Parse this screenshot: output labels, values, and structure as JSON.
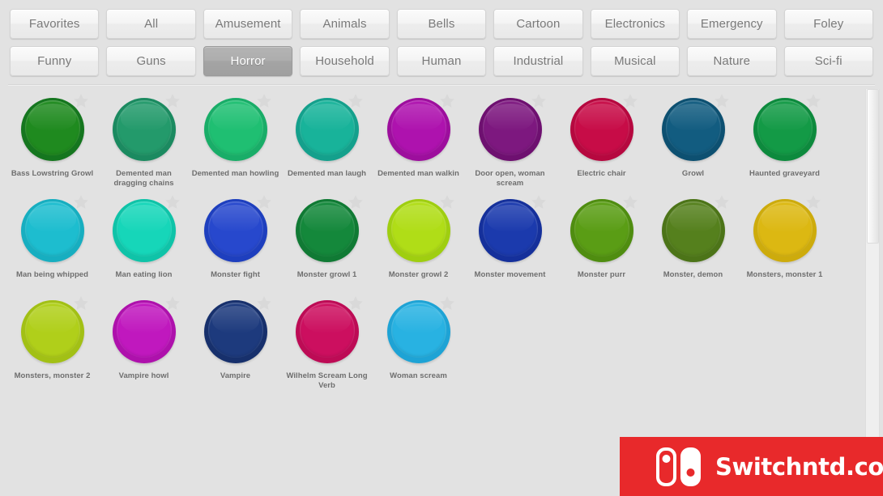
{
  "tabs": {
    "row1": [
      {
        "label": "Favorites",
        "active": false
      },
      {
        "label": "All",
        "active": false
      },
      {
        "label": "Amusement",
        "active": false
      },
      {
        "label": "Animals",
        "active": false
      },
      {
        "label": "Bells",
        "active": false
      },
      {
        "label": "Cartoon",
        "active": false
      },
      {
        "label": "Electronics",
        "active": false
      },
      {
        "label": "Emergency",
        "active": false
      },
      {
        "label": "Foley",
        "active": false
      }
    ],
    "row2": [
      {
        "label": "Funny",
        "active": false
      },
      {
        "label": "Guns",
        "active": false
      },
      {
        "label": "Horror",
        "active": true
      },
      {
        "label": "Household",
        "active": false
      },
      {
        "label": "Human",
        "active": false
      },
      {
        "label": "Industrial",
        "active": false
      },
      {
        "label": "Musical",
        "active": false
      },
      {
        "label": "Nature",
        "active": false
      },
      {
        "label": "Sci-fi",
        "active": false
      }
    ]
  },
  "active_category": "Horror",
  "sounds": [
    {
      "label": "Bass Lowstring Growl",
      "ring": "#15761f",
      "top": "#1f8a1f",
      "favorite": false
    },
    {
      "label": "Demented man dragging chains",
      "ring": "#1b8a60",
      "top": "#239a6b",
      "favorite": false
    },
    {
      "label": "Demented man howling",
      "ring": "#19ad68",
      "top": "#1fbf72",
      "favorite": false
    },
    {
      "label": "Demented man laugh",
      "ring": "#14a08c",
      "top": "#18b39a",
      "favorite": false
    },
    {
      "label": "Demented man walkin",
      "ring": "#9d0e9d",
      "top": "#ae12ae",
      "favorite": false
    },
    {
      "label": "Door open, woman scream",
      "ring": "#6e1070",
      "top": "#7d187f",
      "favorite": false
    },
    {
      "label": "Electric chair",
      "ring": "#b6083f",
      "top": "#c70c47",
      "favorite": false
    },
    {
      "label": "Growl",
      "ring": "#0d5071",
      "top": "#125c80",
      "favorite": false
    },
    {
      "label": "Haunted graveyard",
      "ring": "#0d8a3d",
      "top": "#139a46",
      "favorite": false
    },
    {
      "label": "Man being whipped",
      "ring": "#17aec0",
      "top": "#1dbdcf",
      "favorite": false
    },
    {
      "label": "Man eating lion",
      "ring": "#0fc3a8",
      "top": "#16d6b9",
      "favorite": false
    },
    {
      "label": "Monster fight",
      "ring": "#1e3fbe",
      "top": "#2748cd",
      "favorite": false
    },
    {
      "label": "Monster growl 1",
      "ring": "#107a34",
      "top": "#14883b",
      "favorite": false
    },
    {
      "label": "Monster growl 2",
      "ring": "#9fce10",
      "top": "#b0dd17",
      "favorite": false
    },
    {
      "label": "Monster movement",
      "ring": "#15309b",
      "top": "#1b3aad",
      "favorite": false
    },
    {
      "label": "Monster purr",
      "ring": "#4f8d10",
      "top": "#5a9d15",
      "favorite": false
    },
    {
      "label": "Monster, demon",
      "ring": "#4c7418",
      "top": "#55801d",
      "favorite": false
    },
    {
      "label": "Monsters, monster 1",
      "ring": "#cdab0c",
      "top": "#dcb812",
      "favorite": false
    },
    {
      "label": "Monsters, monster 2",
      "ring": "#a2c015",
      "top": "#b0cf1a",
      "favorite": false
    },
    {
      "label": "Vampire howl",
      "ring": "#ae11ac",
      "top": "#c018be",
      "favorite": false
    },
    {
      "label": "Vampire",
      "ring": "#17306c",
      "top": "#1d3a7d",
      "favorite": false
    },
    {
      "label": "Wilhelm Scream Long Verb",
      "ring": "#bd0b55",
      "top": "#cc0f5f",
      "favorite": false
    },
    {
      "label": "Woman scream",
      "ring": "#1ea3d5",
      "top": "#28b2e2",
      "favorite": false
    }
  ],
  "scrollbar": {
    "thumb_top_pct": 0,
    "thumb_height_pct": 39
  },
  "watermark": {
    "text": "Switchntd.com",
    "background": "#e8292b",
    "logo": "nintendo-switch-logo"
  },
  "icons": {
    "star": "star-icon"
  },
  "colors": {
    "page_background": "#e2e2e2",
    "tab_active": "#a8a8a8",
    "tab_text": "#7a7a7a",
    "label_text": "#6e6e6e"
  }
}
